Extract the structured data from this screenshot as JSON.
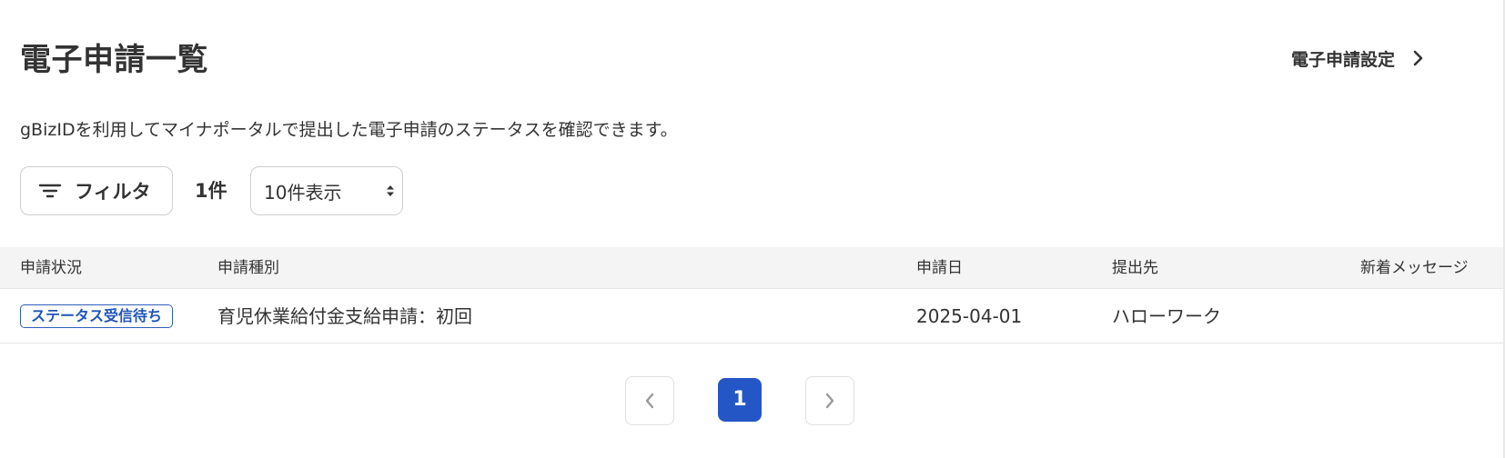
{
  "header": {
    "title": "電子申請一覧",
    "settings_link_label": "電子申請設定",
    "settings_link_icon": "chevron-right-icon"
  },
  "description": "gBizIDを利用してマイナポータルで提出した電子申請のステータスを確認できます。",
  "toolbar": {
    "filter_label": "フィルタ",
    "filter_icon": "filter-icon",
    "result_count": "1件",
    "per_page": {
      "selected": "10件表示"
    }
  },
  "table": {
    "columns": [
      "申請状況",
      "申請種別",
      "申請日",
      "提出先",
      "新着メッセージ"
    ],
    "rows": [
      {
        "status": "ステータス受信待ち",
        "type": "育児休業給付金支給申請：初回",
        "date": "2025-04-01",
        "destination": "ハローワーク",
        "new_message": ""
      }
    ]
  },
  "pagination": {
    "current_page": "1",
    "prev_icon": "chevron-left-icon",
    "next_icon": "chevron-right-icon"
  },
  "colors": {
    "accent": "#2457c5",
    "badge_border": "#2d5fb8",
    "text": "#333333",
    "header_bg": "#f5f4f4"
  }
}
